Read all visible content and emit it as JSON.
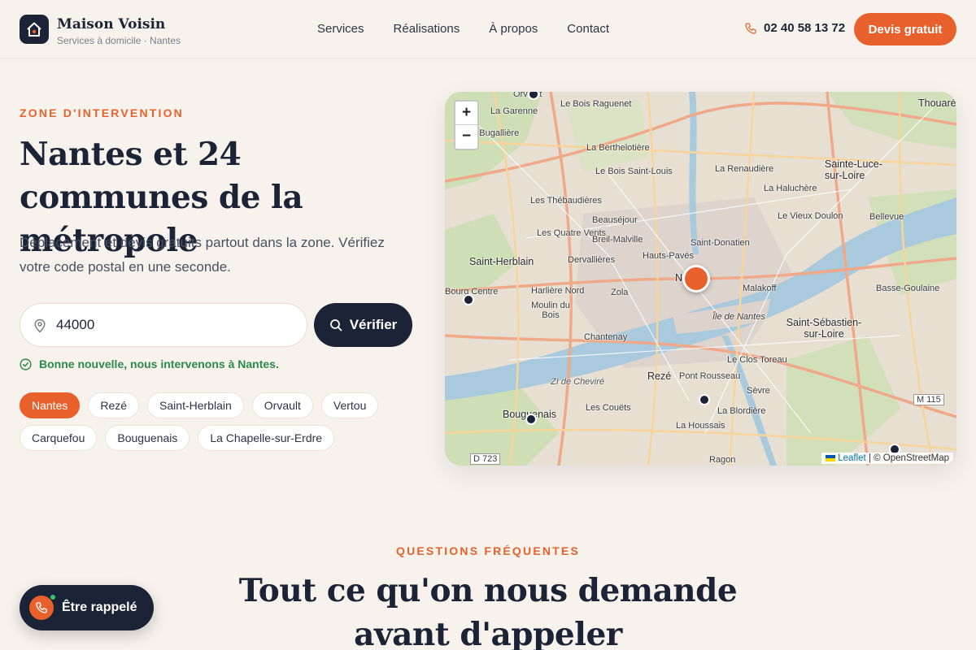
{
  "header": {
    "brand_name": "Maison Voisin",
    "brand_tagline": "Services à domicile · Nantes",
    "logo_icon": "house-icon",
    "nav": [
      "Services",
      "Réalisations",
      "À propos",
      "Contact"
    ],
    "phone": "02 40 58 13 72",
    "cta_label": "Devis gratuit"
  },
  "hero": {
    "eyebrow": "ZONE D'INTERVENTION",
    "title": "Nantes et 24 communes de la métropole",
    "description": "Déplacement et devis gratuits partout dans la zone. Vérifiez votre code postal en une seconde.",
    "search_value": "44000",
    "verify_label": "Vérifier",
    "status_message": "Bonne nouvelle, nous intervenons à Nantes.",
    "chips": {
      "row1": [
        "Nantes",
        "Rezé",
        "Saint-Herblain",
        "Orvault",
        "Vertou"
      ],
      "row2": [
        "Carquefou",
        "Bouguenais",
        "La Chapelle-sur-Erdre"
      ]
    },
    "active_chip": "Nantes"
  },
  "map": {
    "zoom_in": "+",
    "zoom_out": "−",
    "attribution_leaflet": "Leaflet",
    "attribution_sep": " | ",
    "attribution_osm": "© OpenStreetMap",
    "labels": {
      "orvault": "Orvault",
      "la_garenne": "La Garenne",
      "le_bois_raguenet": "Le Bois Raguenet",
      "la_bugalliere": "La Bugallière",
      "la_berthelotiere": "La Berthelotière",
      "le_bois_saint_louis": "Le Bois Saint-Louis",
      "les_thebaudieres": "Les Thébaudières",
      "beausejour": "Beauséjour",
      "les_quatre_vents": "Les Quatre Vents",
      "breil_malville": "Breil-Malville",
      "saint_herblain": "Saint-Herblain",
      "dervallieres": "Dervallières",
      "hauts_paves": "Hauts-Pavés",
      "saint_donatien": "Saint-Donatien",
      "la_renaudiere": "La Renaudière",
      "la_haluchere": "La Haluchère",
      "le_vieux_doulon": "Le Vieux Doulon",
      "sainte_luce": "Sainte-Luce-sur-Loire",
      "thouare": "Thouaré",
      "bellevue": "Bellevue",
      "bourg_centre": "Bourg Centre",
      "harliere_nord": "Harlière Nord",
      "zola": "Zola",
      "nantes": "Nantes",
      "malakoff": "Malakoff",
      "basse_goulaine": "Basse-Goulaine",
      "moulin_du_bois": "Moulin du Bois",
      "ile_de_nantes": "Île de Nantes",
      "chantenay": "Chantenay",
      "saint_sebastien": "Saint-Sébastien-sur-Loire",
      "le_clos_toreau": "Le Clos Toreau",
      "reze": "Rezé",
      "pont_rousseau": "Pont Rousseau",
      "zi_de_cheviré": "ZI de Cheviré",
      "sevre": "Sèvre",
      "bouguenais": "Bouguenais",
      "les_couets": "Les Couëts",
      "la_blordiere": "La Blordière",
      "la_houssais": "La Houssais",
      "ragon": "Ragon",
      "m115": "M 115",
      "d723": "D 723"
    }
  },
  "faq": {
    "eyebrow": "QUESTIONS FRÉQUENTES",
    "title": "Tout ce qu'on nous demande avant d'appeler"
  },
  "callback": {
    "label": "Être rappelé"
  },
  "colors": {
    "accent": "#e8612c",
    "navy": "#1b2436",
    "background": "#f7f2ec",
    "success": "#2a8a4a"
  }
}
